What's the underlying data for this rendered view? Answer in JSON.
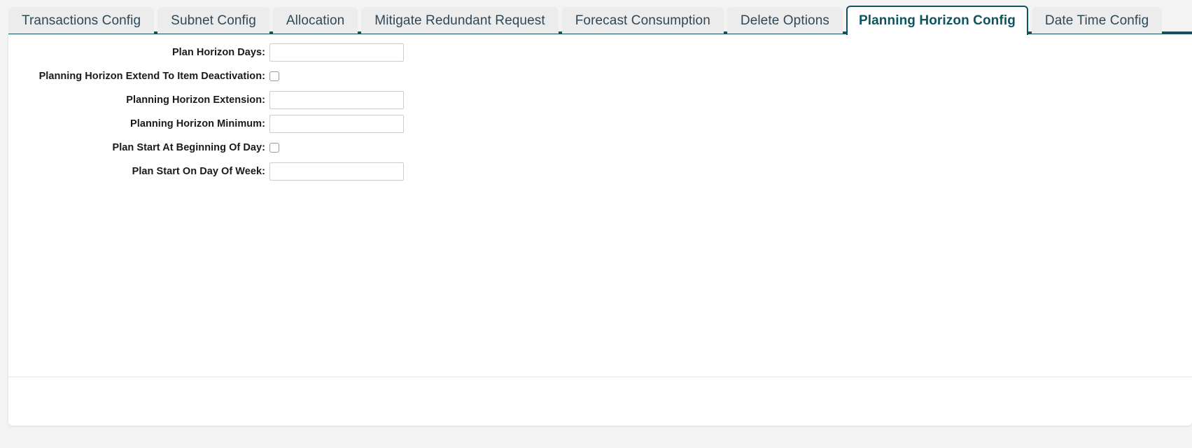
{
  "tabs": [
    {
      "label": "Transactions Config",
      "active": false
    },
    {
      "label": "Subnet Config",
      "active": false
    },
    {
      "label": "Allocation",
      "active": false
    },
    {
      "label": "Mitigate Redundant Request",
      "active": false
    },
    {
      "label": "Forecast Consumption",
      "active": false
    },
    {
      "label": "Delete Options",
      "active": false
    },
    {
      "label": "Planning Horizon Config",
      "active": true
    },
    {
      "label": "Date Time Config",
      "active": false
    }
  ],
  "form": {
    "rows": [
      {
        "label": "Plan Horizon Days:",
        "type": "text",
        "value": "",
        "placeholder": ""
      },
      {
        "label": "Planning Horizon Extend To Item Deactivation:",
        "type": "checkbox",
        "checked": false
      },
      {
        "label": "Planning Horizon Extension:",
        "type": "text",
        "value": "",
        "placeholder": ""
      },
      {
        "label": "Planning Horizon Minimum:",
        "type": "text",
        "value": "",
        "placeholder": ""
      },
      {
        "label": "Plan Start At Beginning Of Day:",
        "type": "checkbox",
        "checked": false
      },
      {
        "label": "Plan Start On Day Of Week:",
        "type": "text",
        "value": "",
        "placeholder": ""
      }
    ]
  },
  "colors": {
    "accent_teal": "#0c5460",
    "tab_inactive_bg": "#ececec",
    "tab_inactive_text": "#2f4858",
    "panel_bg": "#ffffff",
    "page_bg": "#f3f3f3",
    "input_border": "#cccccc",
    "label_text": "#1a1a1a"
  }
}
